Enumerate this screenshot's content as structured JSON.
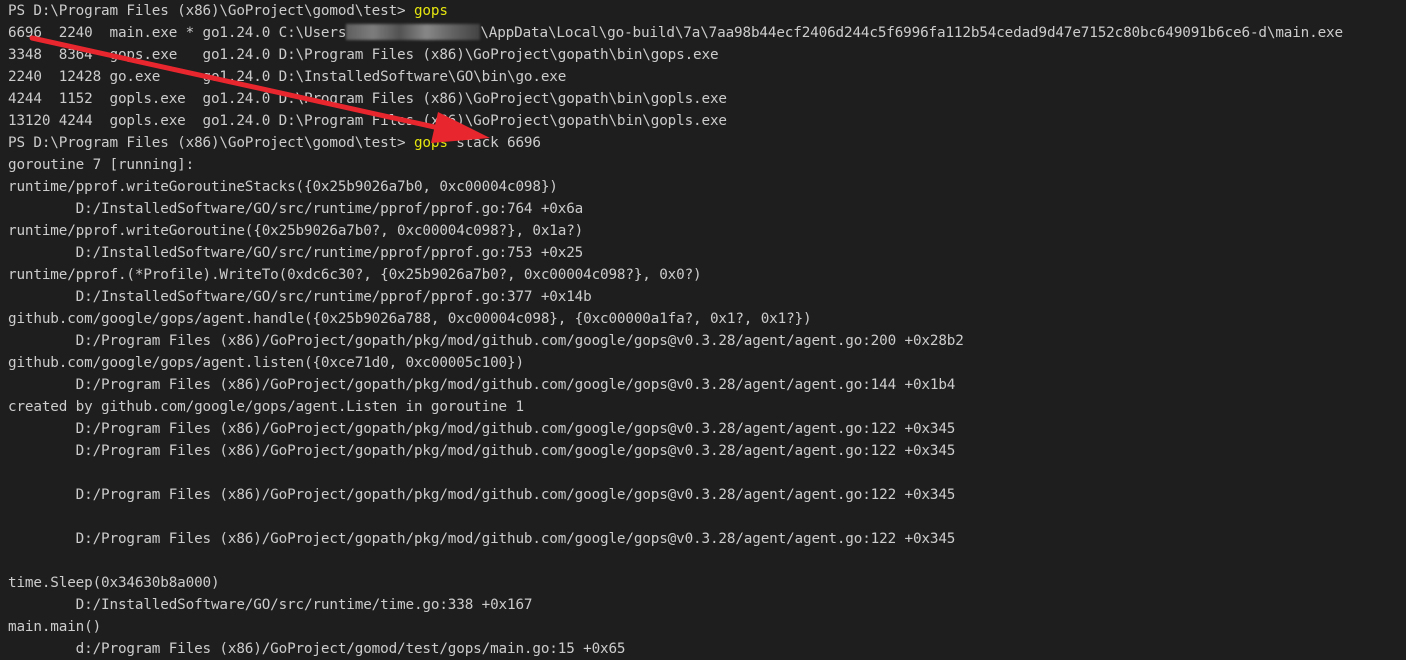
{
  "terminal": {
    "lines": [
      {
        "prompt": "PS D:\\Program Files (x86)\\GoProject\\gomod\\test> ",
        "cmd": "gops"
      },
      {
        "text": "6696  2240  main.exe * go1.24.0 C:\\Users",
        "after_redact": "\\AppData\\Local\\go-build\\7a\\7aa98b44ecf2406d244c5f6996fa112b54cedad9d47e7152c80bc649091b6ce6-d\\main.exe"
      },
      {
        "text": "3348  8364  gops.exe   go1.24.0 D:\\Program Files (x86)\\GoProject\\gopath\\bin\\gops.exe"
      },
      {
        "text": "2240  12428 go.exe     go1.24.0 D:\\InstalledSoftware\\GO\\bin\\go.exe"
      },
      {
        "text": "4244  1152  gopls.exe  go1.24.0 D:\\Program Files (x86)\\GoProject\\gopath\\bin\\gopls.exe"
      },
      {
        "text": "13120 4244  gopls.exe  go1.24.0 D:\\Program Files (x86)\\GoProject\\gopath\\bin\\gopls.exe"
      },
      {
        "prompt": "PS D:\\Program Files (x86)\\GoProject\\gomod\\test> ",
        "cmd": "gops",
        "args": " stack 6696"
      },
      {
        "text": "goroutine 7 [running]:"
      },
      {
        "text": "runtime/pprof.writeGoroutineStacks({0x25b9026a7b0, 0xc00004c098})"
      },
      {
        "text": "        D:/InstalledSoftware/GO/src/runtime/pprof/pprof.go:764 +0x6a"
      },
      {
        "text": "runtime/pprof.writeGoroutine({0x25b9026a7b0?, 0xc00004c098?}, 0x1a?)"
      },
      {
        "text": "        D:/InstalledSoftware/GO/src/runtime/pprof/pprof.go:753 +0x25"
      },
      {
        "text": "runtime/pprof.(*Profile).WriteTo(0xdc6c30?, {0x25b9026a7b0?, 0xc00004c098?}, 0x0?)"
      },
      {
        "text": "        D:/InstalledSoftware/GO/src/runtime/pprof/pprof.go:377 +0x14b"
      },
      {
        "text": "github.com/google/gops/agent.handle({0x25b9026a788, 0xc00004c098}, {0xc00000a1fa?, 0x1?, 0x1?})"
      },
      {
        "text": "        D:/Program Files (x86)/GoProject/gopath/pkg/mod/github.com/google/gops@v0.3.28/agent/agent.go:200 +0x28b2"
      },
      {
        "text": "github.com/google/gops/agent.listen({0xce71d0, 0xc00005c100})"
      },
      {
        "text": "        D:/Program Files (x86)/GoProject/gopath/pkg/mod/github.com/google/gops@v0.3.28/agent/agent.go:144 +0x1b4"
      },
      {
        "text": "created by github.com/google/gops/agent.Listen in goroutine 1"
      },
      {
        "text": "        D:/Program Files (x86)/GoProject/gopath/pkg/mod/github.com/google/gops@v0.3.28/agent/agent.go:122 +0x345"
      },
      {
        "text": "        D:/Program Files (x86)/GoProject/gopath/pkg/mod/github.com/google/gops@v0.3.28/agent/agent.go:122 +0x345"
      },
      {
        "text": ""
      },
      {
        "text": "        D:/Program Files (x86)/GoProject/gopath/pkg/mod/github.com/google/gops@v0.3.28/agent/agent.go:122 +0x345"
      },
      {
        "text": ""
      },
      {
        "text": "        D:/Program Files (x86)/GoProject/gopath/pkg/mod/github.com/google/gops@v0.3.28/agent/agent.go:122 +0x345"
      },
      {
        "text": ""
      },
      {
        "text": "time.Sleep(0x34630b8a000)"
      },
      {
        "text": "        D:/InstalledSoftware/GO/src/runtime/time.go:338 +0x167"
      },
      {
        "text": "main.main()"
      },
      {
        "text": "        d:/Program Files (x86)/GoProject/gomod/test/gops/main.go:15 +0x65"
      }
    ]
  },
  "colors": {
    "background": "#1e1e1e",
    "text": "#cccccc",
    "command": "#e5e510",
    "arrow": "#e8262e"
  },
  "annotation": {
    "arrow_icon": "red-arrow-icon"
  }
}
